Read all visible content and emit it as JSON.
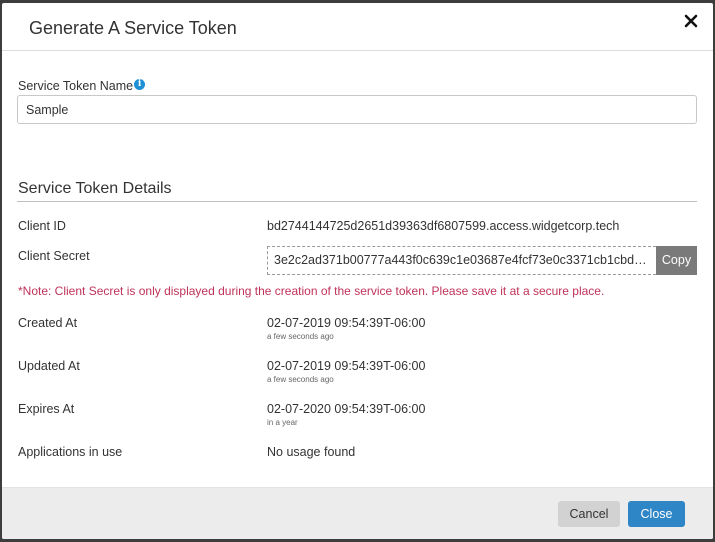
{
  "modal": {
    "title": "Generate A Service Token",
    "close_icon": "close-icon"
  },
  "name_field": {
    "label": "Service Token Name",
    "info_icon": "info-icon",
    "info_glyph": "i",
    "value": "Sample"
  },
  "details": {
    "section_title": "Service Token Details",
    "client_id_label": "Client ID",
    "client_id_value": "bd2744144725d2651d39363df6807599.access.widgetcorp.tech",
    "client_secret_label": "Client Secret",
    "client_secret_value": "3e2c2ad371b00777a443f0c639c1e03687e4fcf73e0c3371cb1cbd6...",
    "copy_label": "Copy",
    "note": "*Note: Client Secret is only displayed during the creation of the service token. Please save it at a secure place.",
    "created_label": "Created At",
    "created_value": "02-07-2019 09:54:39T-06:00",
    "created_relative": "a few seconds ago",
    "updated_label": "Updated At",
    "updated_value": "02-07-2019 09:54:39T-06:00",
    "updated_relative": "a few seconds ago",
    "expires_label": "Expires At",
    "expires_value": "02-07-2020 09:54:39T-06:00",
    "expires_relative": "in a year",
    "apps_label": "Applications in use",
    "apps_value": "No usage found"
  },
  "footer": {
    "cancel_label": "Cancel",
    "close_label": "Close"
  },
  "colors": {
    "note": "#c0325a",
    "primary": "#2f86c6",
    "copy_button": "#7a7a7a",
    "info_icon": "#1f8fd6"
  }
}
